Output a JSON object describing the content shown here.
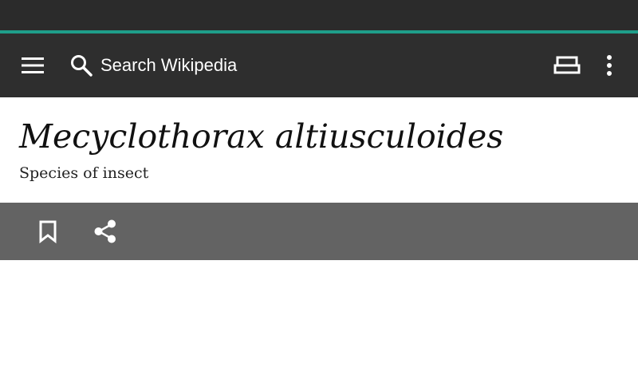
{
  "toolbar": {
    "search_placeholder": "Search Wikipedia",
    "menu_icon": "hamburger-menu-icon",
    "search_icon": "search-icon",
    "reading_icon": "reading-lists-icon",
    "overflow_icon": "overflow-menu-icon"
  },
  "article": {
    "title": "Mecyclothorax altiusculoides",
    "description": "Species of insect"
  },
  "actions": {
    "bookmark_icon": "bookmark-icon",
    "share_icon": "share-icon"
  },
  "colors": {
    "statusbar": "#2b2b2b",
    "accent": "#1f9e8a",
    "toolbar": "#2e2e2e",
    "action_bar": "#636363"
  }
}
